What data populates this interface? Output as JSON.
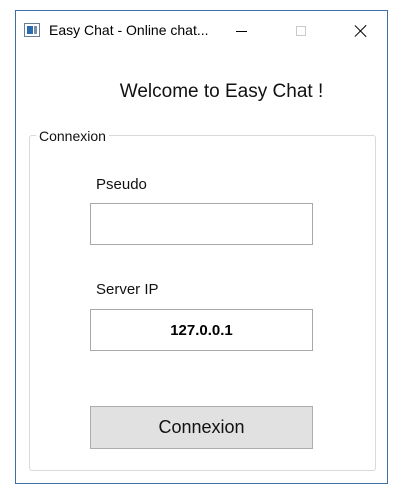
{
  "window": {
    "title": "Easy Chat - Online chat...",
    "icon": "app-window-icon",
    "controls": {
      "minimize_icon": "minimize-icon",
      "maximize_icon": "maximize-icon",
      "close_icon": "close-icon"
    },
    "border_color": "#3c6ea8"
  },
  "main": {
    "welcome_text": "Welcome to Easy Chat !",
    "group": {
      "legend": "Connexion",
      "pseudo_label": "Pseudo",
      "pseudo_value": "",
      "server_ip_label": "Server IP",
      "server_ip_value": "127.0.0.1",
      "connect_button_label": "Connexion"
    }
  }
}
